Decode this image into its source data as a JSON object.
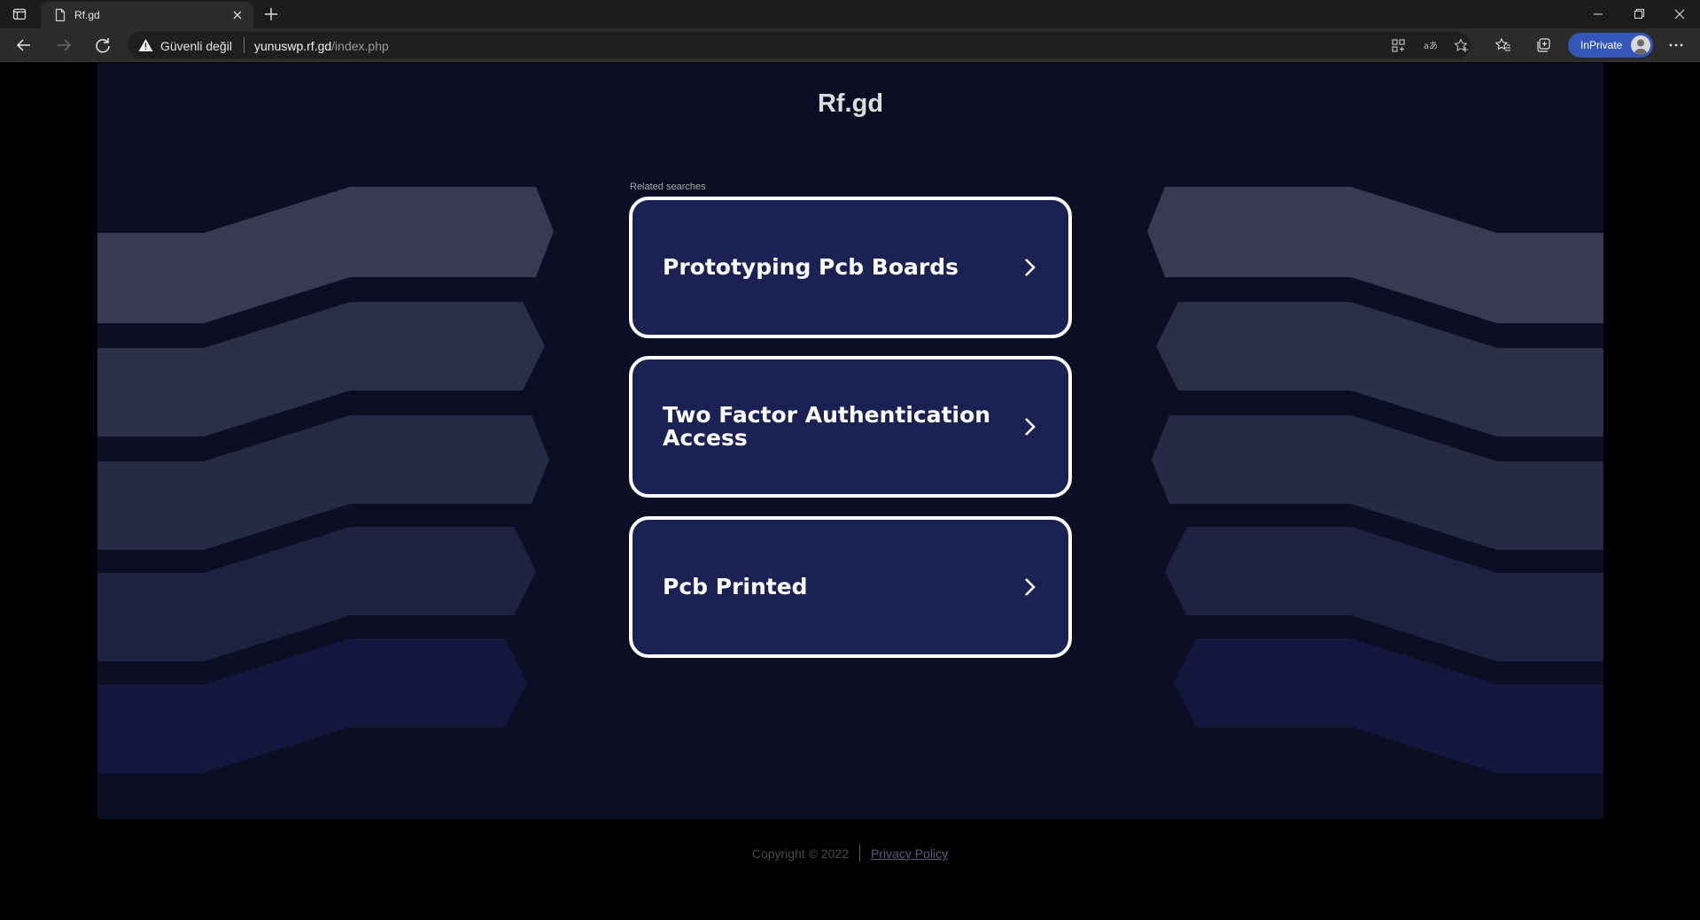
{
  "browser": {
    "tab_title": "Rf.gd",
    "security_label": "Güvenli değil",
    "url_host": "yunuswp.rf.gd",
    "url_path": "/index.php",
    "inprivate_label": "InPrivate",
    "accent_color": "#3456b8"
  },
  "page": {
    "title": "Rf.gd",
    "related_label": "Related searches",
    "cards": [
      {
        "label": "Prototyping Pcb Boards"
      },
      {
        "label": "Two Factor Authentication Access"
      },
      {
        "label": "Pcb Printed"
      }
    ],
    "background_color": "#0c0f24",
    "card_color": "#1c2153"
  },
  "footer": {
    "copyright": "Copyright © 2022",
    "privacy_link": "Privacy Policy"
  }
}
